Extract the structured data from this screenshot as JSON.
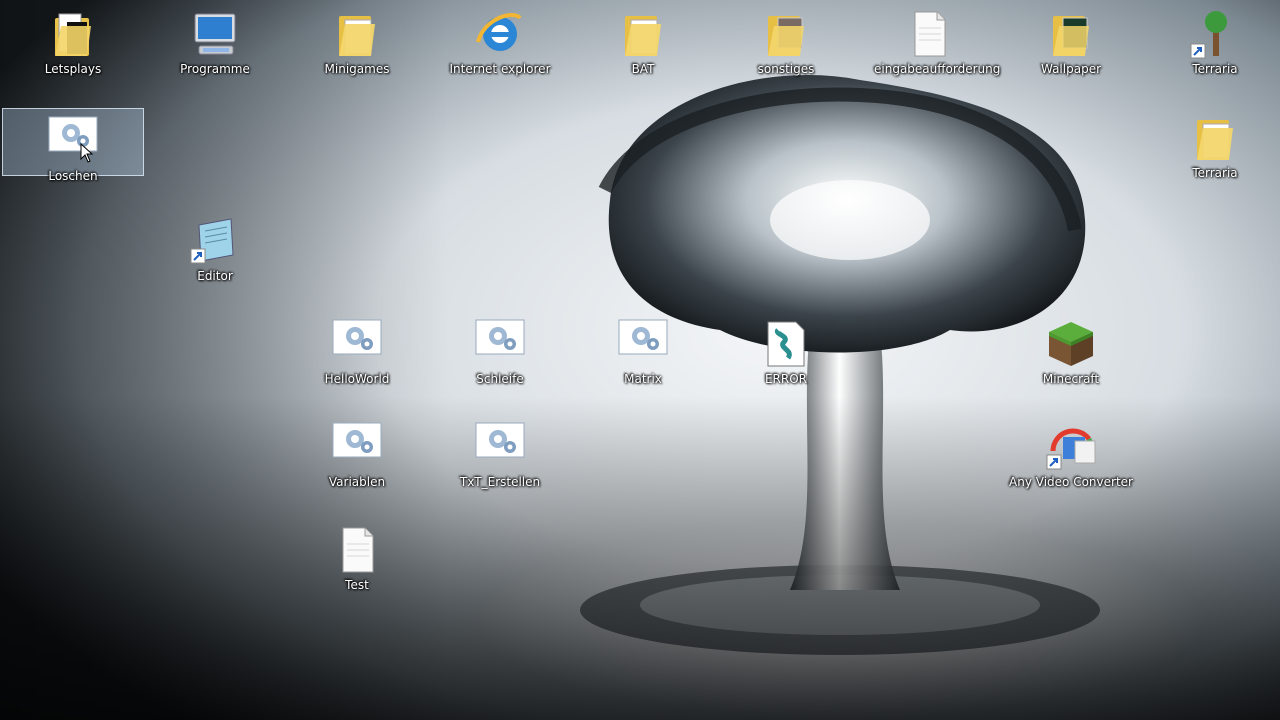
{
  "desktop": {
    "icons": [
      {
        "label": "Letsplays",
        "icon": "folder-icon"
      },
      {
        "label": "Programme",
        "icon": "computer-icon"
      },
      {
        "label": "Minigames",
        "icon": "folder-icon"
      },
      {
        "label": "Internet explorer",
        "icon": "internet-explorer-icon"
      },
      {
        "label": "BAT",
        "icon": "folder-icon"
      },
      {
        "label": "sonstiges",
        "icon": "folder-icon"
      },
      {
        "label": "eingabeaufforderung",
        "icon": "text-file-icon"
      },
      {
        "label": "Wallpaper",
        "icon": "folder-icon"
      },
      {
        "label": "Terraria",
        "icon": "terraria-shortcut-icon"
      },
      {
        "label": "Loschen",
        "icon": "batch-file-icon"
      },
      {
        "label": "Terraria",
        "icon": "folder-icon"
      },
      {
        "label": "Editor",
        "icon": "notepad-shortcut-icon"
      },
      {
        "label": "HelloWorld",
        "icon": "batch-file-icon"
      },
      {
        "label": "Schleife",
        "icon": "batch-file-icon"
      },
      {
        "label": "Matrix",
        "icon": "batch-file-icon"
      },
      {
        "label": "ERROR",
        "icon": "script-icon"
      },
      {
        "label": "Minecraft",
        "icon": "minecraft-icon"
      },
      {
        "label": "Variablen",
        "icon": "batch-file-icon"
      },
      {
        "label": "TxT_Erstellen",
        "icon": "batch-file-icon"
      },
      {
        "label": "Any Video Converter",
        "icon": "video-converter-icon"
      },
      {
        "label": "Test",
        "icon": "text-file-icon"
      }
    ]
  }
}
